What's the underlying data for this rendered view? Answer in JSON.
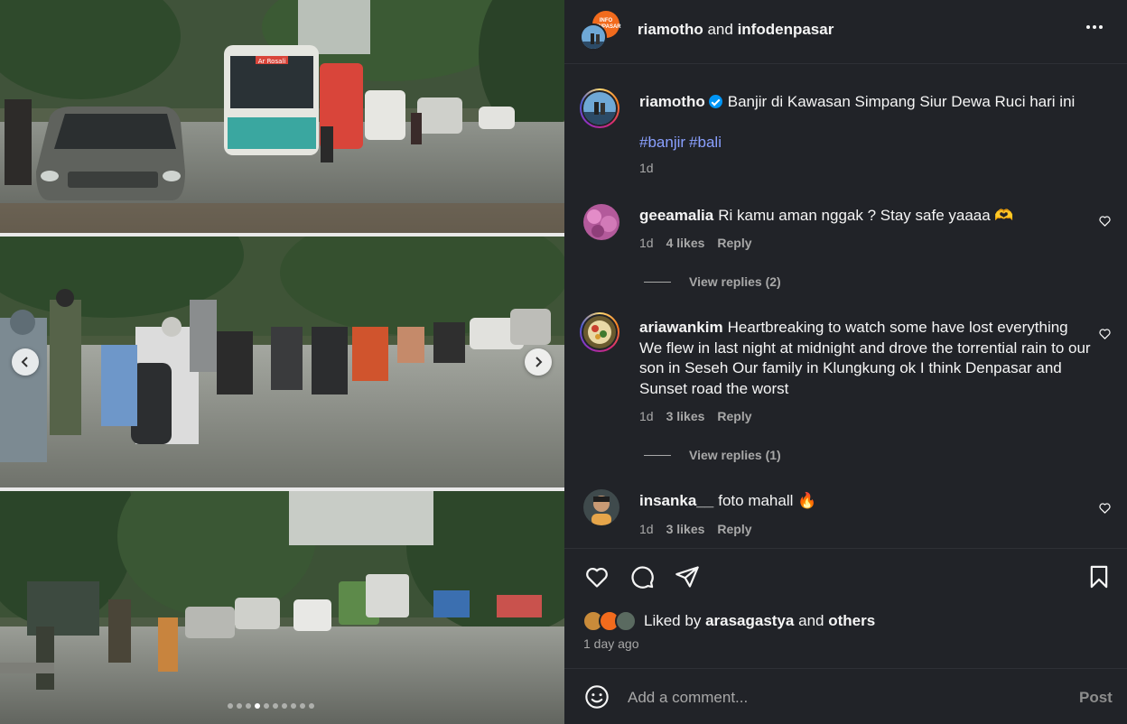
{
  "header": {
    "user1": "riamotho",
    "conjunction": "and",
    "user2": "infodenpasar",
    "badge_text": "INFO DENPASAR",
    "more_icon": "more-horizontal-icon"
  },
  "carousel": {
    "photo_count": 10,
    "active_index": 3,
    "prev_icon": "chevron-left-icon",
    "next_icon": "chevron-right-icon",
    "bus_sign": "Ar Rosali"
  },
  "caption": {
    "username": "riamotho",
    "verified": true,
    "text": "Banjir di Kawasan Simpang Siur Dewa Ruci hari ini",
    "hashtags": [
      "#banjir",
      "#bali"
    ],
    "time": "1d"
  },
  "comments": [
    {
      "username": "geeamalia",
      "text": "Ri kamu aman nggak ? Stay safe yaaaa 🫶",
      "time": "1d",
      "likes": "4 likes",
      "reply": "Reply",
      "view_replies": "View replies (2)"
    },
    {
      "username": "ariawankim",
      "text": "Heartbreaking to watch some have lost everything We flew in last night at midnight and drove the torrential rain to our son in Seseh Our family in Klungkung ok I think Denpasar and Sunset road the worst",
      "time": "1d",
      "likes": "3 likes",
      "reply": "Reply",
      "view_replies": "View replies (1)"
    },
    {
      "username": "insanka__",
      "text": "foto mahall 🔥",
      "time": "1d",
      "likes": "3 likes",
      "reply": "Reply"
    }
  ],
  "actions": {
    "like_icon": "heart-icon",
    "comment_icon": "comment-icon",
    "share_icon": "share-icon",
    "save_icon": "bookmark-icon"
  },
  "likes": {
    "prefix": "Liked by",
    "user": "arasagastya",
    "and": "and",
    "others": "others"
  },
  "posted": "1 day ago",
  "comment_box": {
    "placeholder": "Add a comment...",
    "post_label": "Post",
    "emoji_icon": "emoji-smile-icon"
  },
  "colors": {
    "panel_bg": "#212328",
    "link": "#8aa0ff",
    "verified": "#0095f6",
    "muted": "#a8a8a8"
  }
}
